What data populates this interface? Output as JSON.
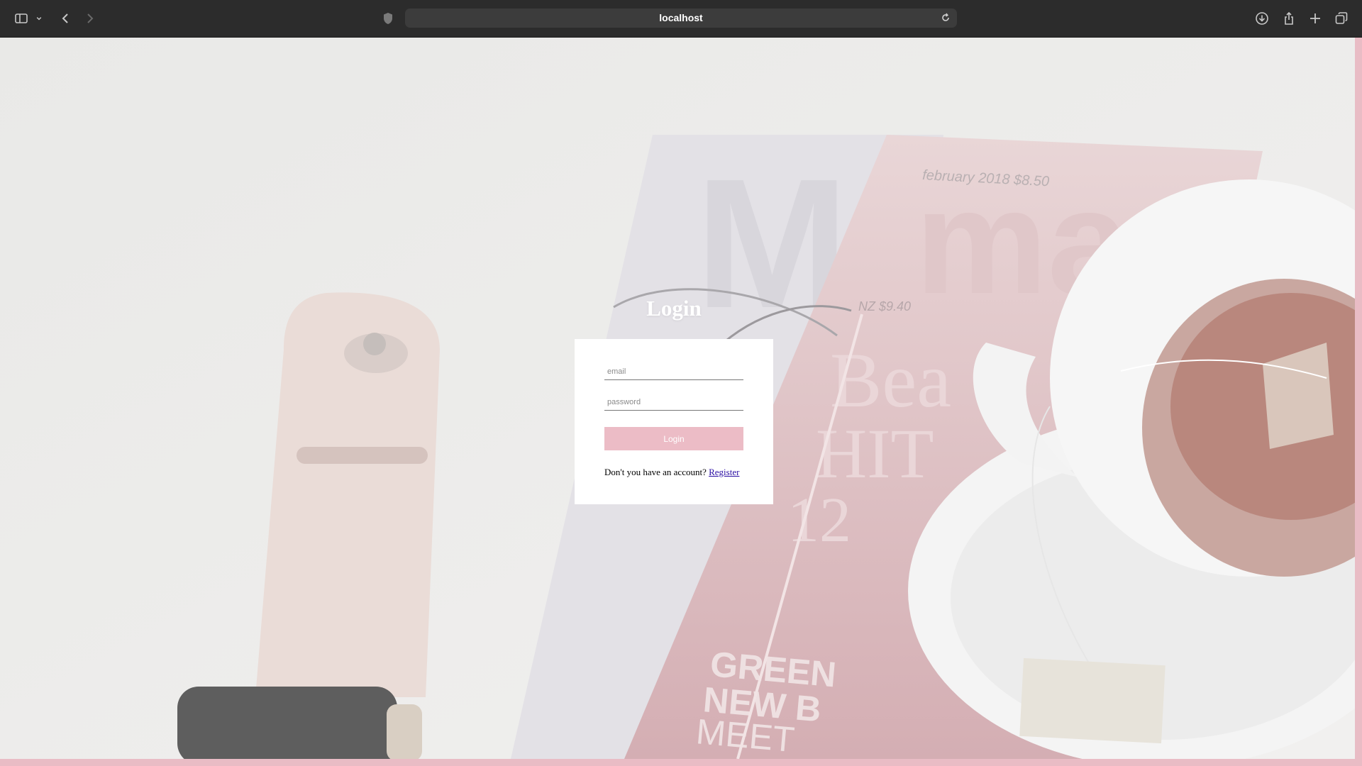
{
  "browser": {
    "url": "localhost",
    "icons": {
      "sidebar": "sidebar-icon",
      "sidebar_menu": "chevron-down-icon",
      "back": "back-arrow-icon",
      "forward": "forward-arrow-icon",
      "privacy": "shield-icon",
      "reload": "reload-icon",
      "downloads": "download-icon",
      "share": "share-icon",
      "new_tab": "plus-icon",
      "tabs": "tab-overview-icon"
    }
  },
  "login": {
    "title": "Login",
    "email_placeholder": "email",
    "password_placeholder": "password",
    "button_label": "Login",
    "register_prompt": "Don't you have an account?",
    "register_link": "Register"
  },
  "colors": {
    "accent": "#ecbcc6",
    "frame": "#e9bcc5",
    "link": "#2a0ea3"
  }
}
